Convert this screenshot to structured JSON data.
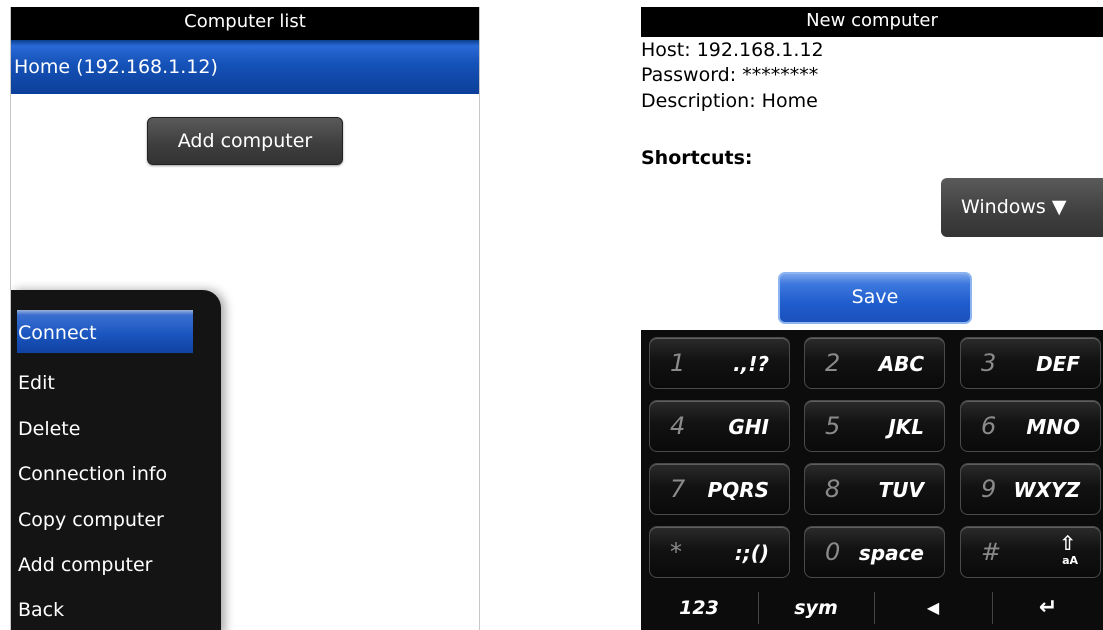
{
  "left": {
    "title": "Computer list",
    "selected_item": "Home (192.168.1.12)",
    "add_button": "Add computer",
    "menu": [
      "Connect",
      "Edit",
      "Delete",
      "Connection info",
      "Copy computer",
      "Add computer",
      "Back"
    ]
  },
  "right": {
    "title": "New computer",
    "host": "Host: 192.168.1.12",
    "password": "Password: ********",
    "description": "Description: Home",
    "shortcuts_label": "Shortcuts:",
    "dropdown_value": "Windows ▼",
    "save_button": "Save",
    "keys": [
      {
        "num": "1",
        "label": ".,!?"
      },
      {
        "num": "2",
        "label": "ABC"
      },
      {
        "num": "3",
        "label": "DEF"
      },
      {
        "num": "4",
        "label": "GHI"
      },
      {
        "num": "5",
        "label": "JKL"
      },
      {
        "num": "6",
        "label": "MNO"
      },
      {
        "num": "7",
        "label": "PQRS"
      },
      {
        "num": "8",
        "label": "TUV"
      },
      {
        "num": "9",
        "label": "WXYZ"
      },
      {
        "num": "*",
        "label": ":;()"
      },
      {
        "num": "0",
        "label": "space"
      },
      {
        "num": "#",
        "label": "⇧"
      }
    ],
    "bottom": [
      "123",
      "sym",
      "◀",
      "↵"
    ],
    "shift_sub": "aA"
  }
}
